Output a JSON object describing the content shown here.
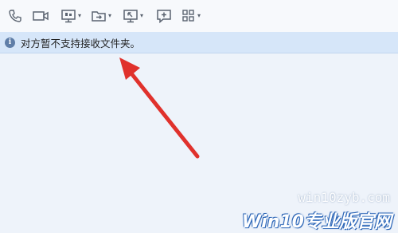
{
  "toolbar": {
    "buttons": [
      {
        "name": "phone-call",
        "icon": "phone-icon",
        "has_menu": false
      },
      {
        "name": "video-call",
        "icon": "video-camera-icon",
        "has_menu": false
      },
      {
        "name": "screen-share",
        "icon": "monitor-icon",
        "has_menu": true
      },
      {
        "name": "send-file",
        "icon": "file-transfer-icon",
        "has_menu": true
      },
      {
        "name": "remote-desktop",
        "icon": "remote-desktop-icon",
        "has_menu": true
      },
      {
        "name": "new-discussion",
        "icon": "add-chat-icon",
        "has_menu": false
      },
      {
        "name": "apps",
        "icon": "apps-grid-icon",
        "has_menu": true
      }
    ],
    "caret_glyph": "▾"
  },
  "notice": {
    "info_glyph": "i",
    "message": "对方暂不支持接收文件夹。"
  },
  "colors": {
    "notice_bg": "#d6e6f9",
    "arrow": "#e0312c"
  },
  "watermark": {
    "site": "win10zyb.com",
    "brand": "Win10专业版官网"
  }
}
